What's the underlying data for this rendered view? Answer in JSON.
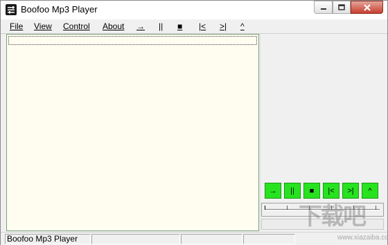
{
  "window": {
    "title": "Boofoo Mp3 Player"
  },
  "menu": {
    "items": [
      {
        "label": "File"
      },
      {
        "label": "View"
      },
      {
        "label": "Control"
      },
      {
        "label": "About"
      }
    ],
    "toolbar": [
      {
        "glyph": "→",
        "icon": "play-icon"
      },
      {
        "glyph": "||",
        "icon": "pause-icon"
      },
      {
        "glyph": "■",
        "icon": "stop-icon"
      },
      {
        "glyph": "|<",
        "icon": "previous-icon"
      },
      {
        "glyph": ">|",
        "icon": "next-icon"
      },
      {
        "glyph": "^",
        "icon": "eject-icon"
      }
    ]
  },
  "controls": [
    {
      "glyph": "→",
      "icon": "play-icon"
    },
    {
      "glyph": "||",
      "icon": "pause-icon"
    },
    {
      "glyph": "■",
      "icon": "stop-icon"
    },
    {
      "glyph": "|<",
      "icon": "previous-icon"
    },
    {
      "glyph": ">|",
      "icon": "next-icon"
    },
    {
      "glyph": "^",
      "icon": "eject-icon"
    }
  ],
  "status": {
    "app_name": "Boofoo Mp3 Player"
  },
  "watermark": {
    "text": "下载吧",
    "url": "www.xiazaiba.com"
  },
  "colors": {
    "controls_green": "#27e31f",
    "playlist_bg": "#fffcf0"
  }
}
